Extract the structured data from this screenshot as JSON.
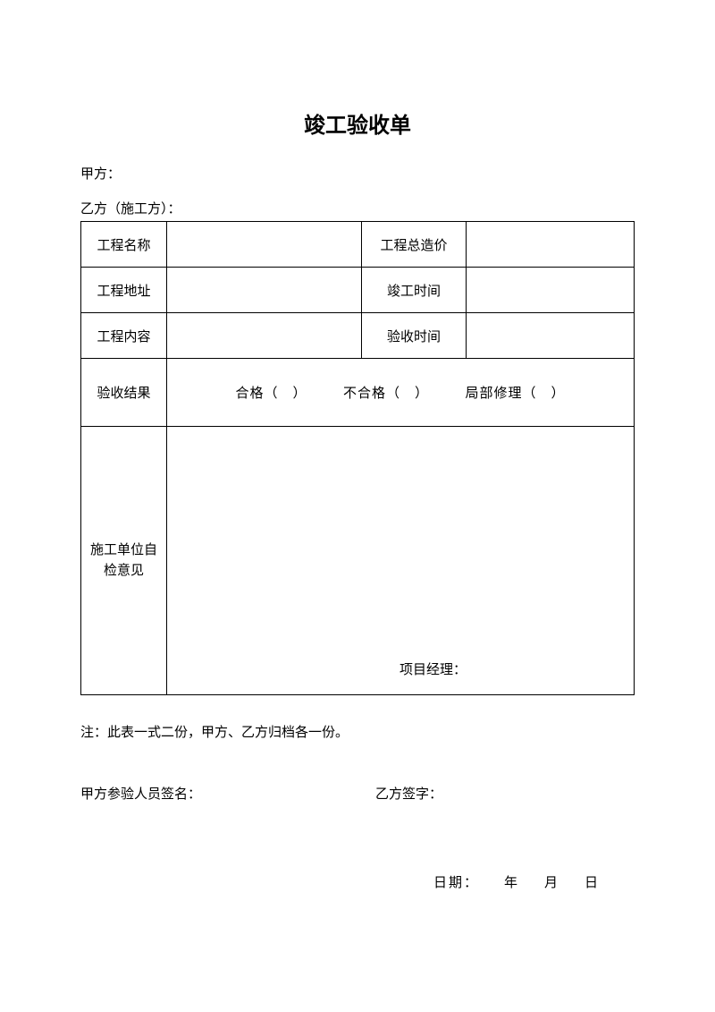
{
  "title": "竣工验收单",
  "partyA": "甲方：",
  "partyB": "乙方（施工方）：",
  "table": {
    "row1": {
      "label1": "工程名称",
      "label2": "工程总造价"
    },
    "row2": {
      "label1": "工程地址",
      "label2": "竣工时间"
    },
    "row3": {
      "label1": "工程内容",
      "label2": "验收时间"
    },
    "row4": {
      "label": "验收结果",
      "options": "合格（　）　　　不合格（　）　　　局部修理（　）"
    },
    "row5": {
      "label": "施工单位自\n检意见",
      "pm": "项目经理："
    }
  },
  "note": "注：此表一式二份，甲方、乙方归档各一份。",
  "signA": "甲方参验人员签名：",
  "signB": "乙方签字：",
  "date": {
    "label": "日期：",
    "year": "年",
    "month": "月",
    "day": "日"
  }
}
